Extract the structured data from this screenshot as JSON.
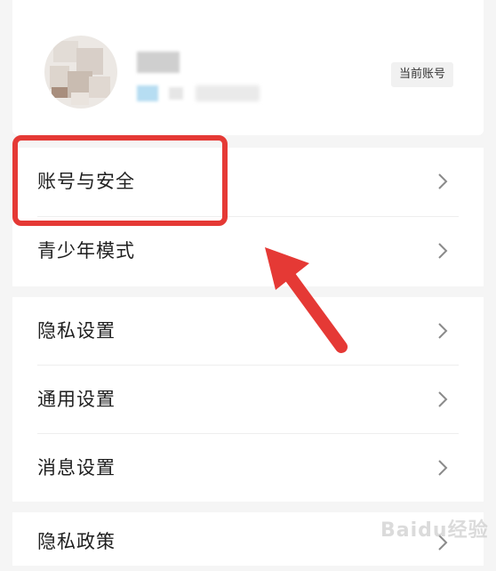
{
  "account": {
    "current_badge": "当前账号"
  },
  "menu_group_1": [
    {
      "label": "账号与安全"
    },
    {
      "label": "青少年模式"
    }
  ],
  "menu_group_2": [
    {
      "label": "隐私设置"
    },
    {
      "label": "通用设置"
    },
    {
      "label": "消息设置"
    }
  ],
  "menu_group_3": [
    {
      "label": "隐私政策"
    }
  ],
  "icons": {
    "row_chevron": "chevron-right-icon",
    "annotation": "arrow-icon"
  },
  "colors": {
    "annotation_red": "#e53935",
    "page_background": "#f5f5f5"
  },
  "watermark": "Baidu经验"
}
